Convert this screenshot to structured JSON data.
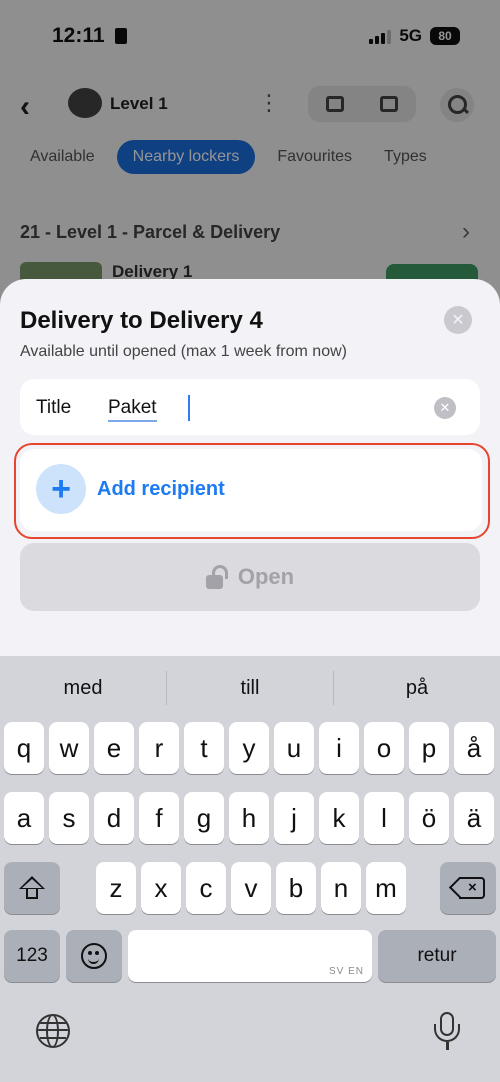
{
  "status_bar": {
    "time": "12:11",
    "network": "5G",
    "battery": "80"
  },
  "background_app": {
    "level_title": "Level 1",
    "filters": [
      "Available",
      "Nearby lockers",
      "Favourites",
      "Types"
    ],
    "section_title": "21 - Level 1 - Parcel & Delivery",
    "row_title": "Delivery 1"
  },
  "sheet": {
    "title": "Delivery to Delivery 4",
    "subtitle": "Available until opened (max 1 week from now)",
    "title_field": {
      "label": "Title",
      "value": "Paket"
    },
    "add_recipient_label": "Add recipient",
    "open_label": "Open"
  },
  "keyboard": {
    "predictions": [
      "med",
      "till",
      "på"
    ],
    "row1": [
      "q",
      "w",
      "e",
      "r",
      "t",
      "y",
      "u",
      "i",
      "o",
      "p",
      "å"
    ],
    "row2": [
      "a",
      "s",
      "d",
      "f",
      "g",
      "h",
      "j",
      "k",
      "l",
      "ö",
      "ä"
    ],
    "row3": [
      "z",
      "x",
      "c",
      "v",
      "b",
      "n",
      "m"
    ],
    "numbers_key": "123",
    "space_caption": "SV EN",
    "return_key": "retur"
  },
  "colors": {
    "accent": "#1d7af3",
    "highlight": "#e8452f",
    "active_filter": "#1b6fe0"
  }
}
